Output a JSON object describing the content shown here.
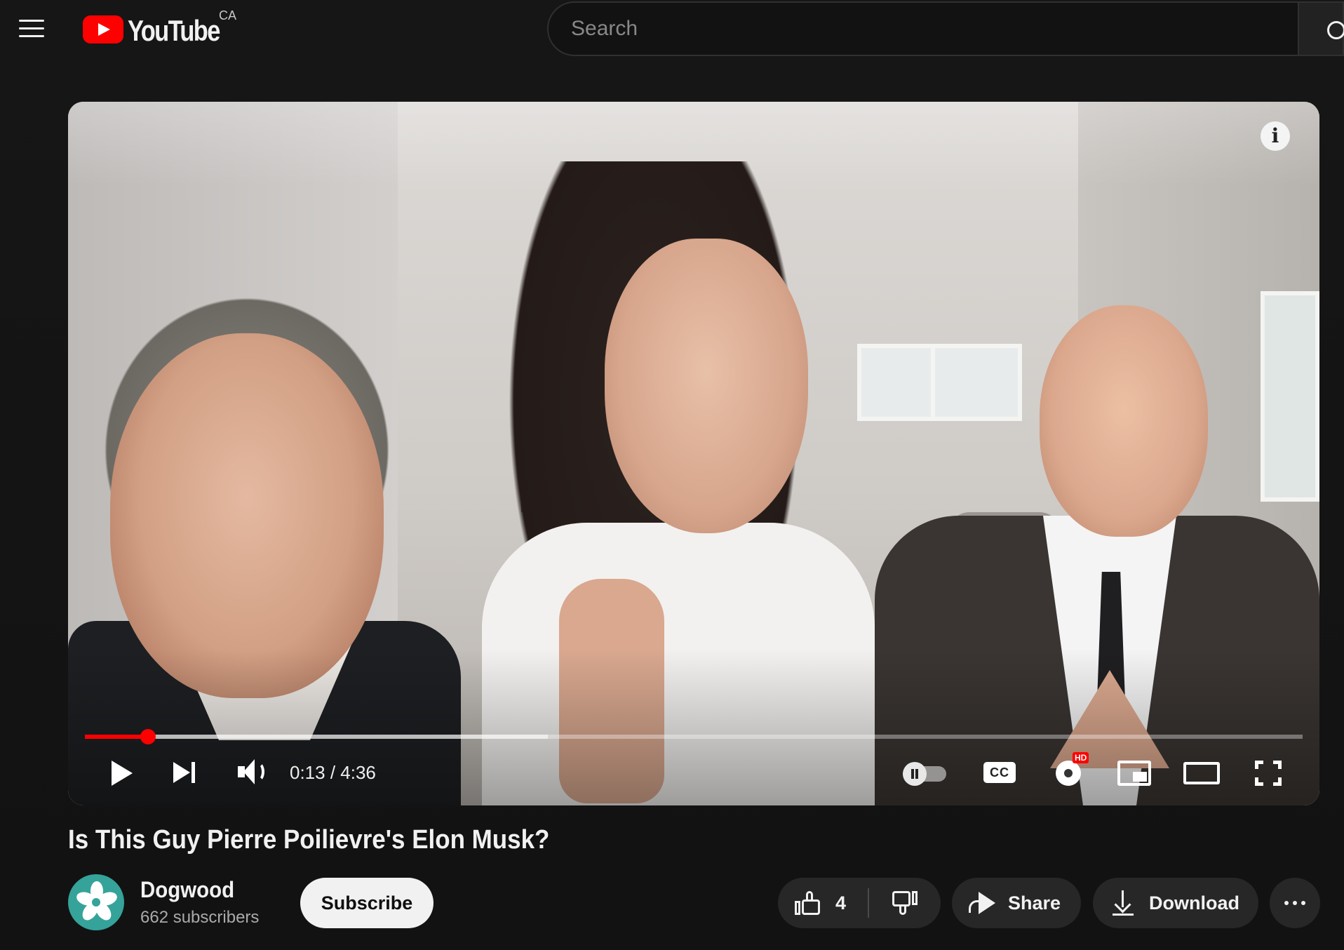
{
  "header": {
    "brand": "YouTube",
    "country_code": "CA",
    "search": {
      "placeholder": "Search",
      "value": ""
    }
  },
  "player": {
    "time": {
      "current": "0:13",
      "separator": " / ",
      "duration": "4:36"
    },
    "progress_played_fraction": 0.052,
    "progress_buffered_fraction": 0.38,
    "settings_badge": "HD",
    "cc_label": "CC",
    "info_icon": "i"
  },
  "video": {
    "title": "Is This Guy Pierre Poilievre's Elon Musk?",
    "channel": {
      "name": "Dogwood",
      "subscribers": "662 subscribers"
    },
    "subscribe_label": "Subscribe",
    "like_count": "4",
    "share_label": "Share",
    "download_label": "Download"
  },
  "colors": {
    "background": "#0f0f0f",
    "accent": "#ff0000",
    "pill": "#272727",
    "channel_avatar": "#35a39a"
  },
  "icons": [
    "menu-icon",
    "youtube-logo-icon",
    "search-icon",
    "info-icon",
    "play-icon",
    "next-icon",
    "volume-icon",
    "autoplay-toggle-icon",
    "cc-icon",
    "gear-icon",
    "miniplayer-icon",
    "theater-icon",
    "fullscreen-icon",
    "thumbs-up-icon",
    "thumbs-down-icon",
    "share-icon",
    "download-icon",
    "more-icon"
  ]
}
